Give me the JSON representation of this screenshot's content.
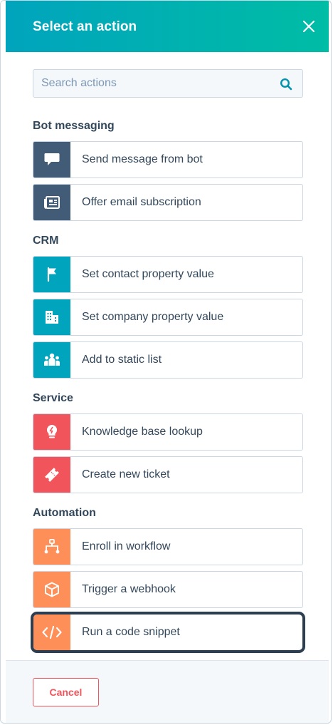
{
  "header": {
    "title": "Select an action"
  },
  "search": {
    "placeholder": "Search actions",
    "value": ""
  },
  "sections": [
    {
      "title": "Bot messaging",
      "items": [
        {
          "label": "Send message from bot",
          "icon": "speech-bubble-icon",
          "color": "#425b76"
        },
        {
          "label": "Offer email subscription",
          "icon": "newspaper-icon",
          "color": "#425b76"
        }
      ]
    },
    {
      "title": "CRM",
      "items": [
        {
          "label": "Set contact property value",
          "icon": "flag-icon",
          "color": "#00a4bd"
        },
        {
          "label": "Set company property value",
          "icon": "building-icon",
          "color": "#00a4bd"
        },
        {
          "label": "Add to static list",
          "icon": "people-icon",
          "color": "#00a4bd"
        }
      ]
    },
    {
      "title": "Service",
      "items": [
        {
          "label": "Knowledge base lookup",
          "icon": "lightbulb-icon",
          "color": "#f2545b"
        },
        {
          "label": "Create new ticket",
          "icon": "ticket-icon",
          "color": "#f2545b"
        }
      ]
    },
    {
      "title": "Automation",
      "items": [
        {
          "label": "Enroll in workflow",
          "icon": "workflow-icon",
          "color": "#ff8f59"
        },
        {
          "label": "Trigger a webhook",
          "icon": "cube-icon",
          "color": "#ff8f59"
        },
        {
          "label": "Run a code snippet",
          "icon": "code-icon",
          "color": "#ff8f59",
          "focused": true
        }
      ]
    }
  ],
  "footer": {
    "cancel_label": "Cancel"
  }
}
